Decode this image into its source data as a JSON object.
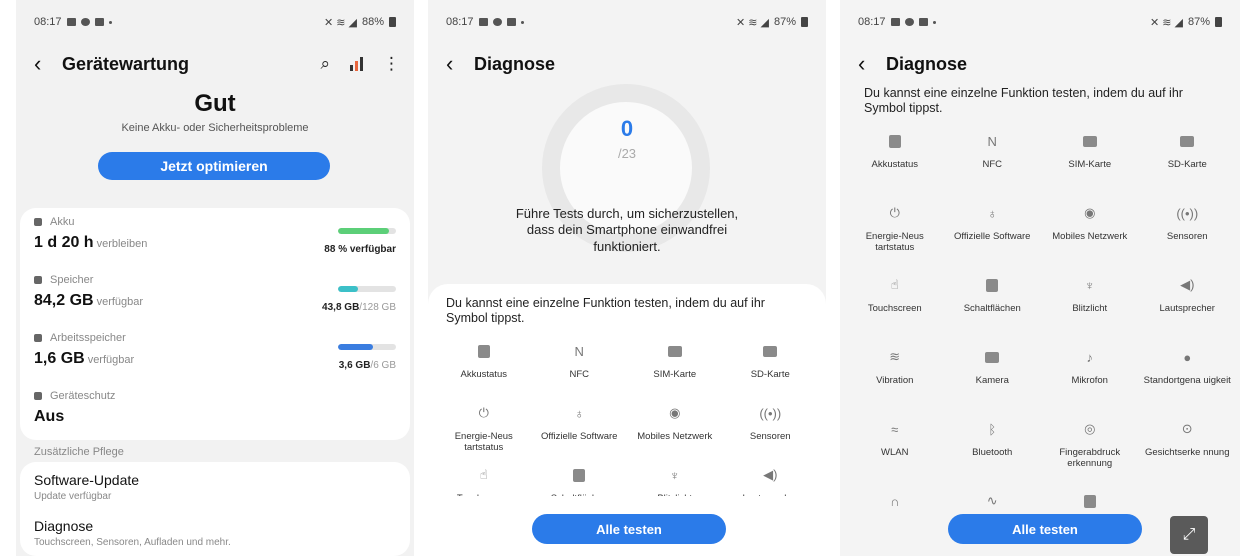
{
  "screen1": {
    "statusbar": {
      "time": "08:17",
      "battery": "88%"
    },
    "title": "Gerätewartung",
    "status": "Gut",
    "status_sub": "Keine Akku- oder Sicherheitsprobleme",
    "optimize_label": "Jetzt optimieren",
    "stats": [
      {
        "label": "Akku",
        "value": "1 d 20 h",
        "unit": "verbleiben",
        "meta_main": "88 % verfügbar",
        "meta_dim": "",
        "fill": 0.88,
        "color": "#5ccf78"
      },
      {
        "label": "Speicher",
        "value": "84,2 GB",
        "unit": "verfügbar",
        "meta_main": "43,8 GB",
        "meta_dim": "/128 GB",
        "fill": 0.34,
        "color": "#3cc0c8"
      },
      {
        "label": "Arbeitsspeicher",
        "value": "1,6 GB",
        "unit": "verfügbar",
        "meta_main": "3,6 GB",
        "meta_dim": "/6 GB",
        "fill": 0.6,
        "color": "#3a7de0"
      },
      {
        "label": "Geräteschutz",
        "value": "Aus",
        "unit": "",
        "meta_main": "",
        "meta_dim": "",
        "fill": null,
        "color": ""
      }
    ],
    "section_label": "Zusätzliche Pflege",
    "items": [
      {
        "title": "Software-Update",
        "sub": "Update verfügbar"
      },
      {
        "title": "Diagnose",
        "sub": "Touchscreen, Sensoren, Aufladen und mehr."
      }
    ]
  },
  "screen2": {
    "statusbar": {
      "time": "08:17",
      "battery": "87%"
    },
    "title": "Diagnose",
    "ring_value": "0",
    "ring_total": "/23",
    "text": "Führe Tests durch, um sicherzustellen, dass dein Smartphone einwandfrei funktioniert.",
    "hint": "Du kannst eine einzelne Funktion testen, indem du auf ihr Symbol tippst.",
    "button": "Alle testen"
  },
  "screen3": {
    "statusbar": {
      "time": "08:17",
      "battery": "87%"
    },
    "title": "Diagnose",
    "hint": "Du kannst eine einzelne Funktion testen, indem du auf ihr Symbol tippst.",
    "button": "Alle testen"
  },
  "functions": [
    {
      "name": "Akkustatus",
      "icon": "battery-icon",
      "glyph": "box"
    },
    {
      "name": "NFC",
      "icon": "nfc-icon",
      "glyph": "N"
    },
    {
      "name": "SIM-Karte",
      "icon": "sim-card-icon",
      "glyph": "wide"
    },
    {
      "name": "SD-Karte",
      "icon": "sd-card-icon",
      "glyph": "wide"
    },
    {
      "name": "Energie-Neus tartstatus",
      "icon": "power-icon",
      "glyph": "⏻"
    },
    {
      "name": "Offizielle Software",
      "icon": "badge-icon",
      "glyph": "♁"
    },
    {
      "name": "Mobiles Netzwerk",
      "icon": "cell-network-icon",
      "glyph": "◉"
    },
    {
      "name": "Sensoren",
      "icon": "sensors-icon",
      "glyph": "((•))"
    },
    {
      "name": "Touchscreen",
      "icon": "touch-icon",
      "glyph": "☝"
    },
    {
      "name": "Schaltflächen",
      "icon": "buttons-icon",
      "glyph": "box"
    },
    {
      "name": "Blitzlicht",
      "icon": "flashlight-icon",
      "glyph": "♆"
    },
    {
      "name": "Lautsprecher",
      "icon": "speaker-icon",
      "glyph": "◀)"
    },
    {
      "name": "Vibration",
      "icon": "vibration-icon",
      "glyph": "≋"
    },
    {
      "name": "Kamera",
      "icon": "camera-icon",
      "glyph": "wide"
    },
    {
      "name": "Mikrofon",
      "icon": "microphone-icon",
      "glyph": "♪"
    },
    {
      "name": "Standortgena uigkeit",
      "icon": "location-icon",
      "glyph": "●"
    },
    {
      "name": "WLAN",
      "icon": "wifi-icon",
      "glyph": "≈"
    },
    {
      "name": "Bluetooth",
      "icon": "bluetooth-icon",
      "glyph": "ᛒ"
    },
    {
      "name": "Fingerabdruck erkennung",
      "icon": "fingerprint-icon",
      "glyph": "◎"
    },
    {
      "name": "Gesichtserke nnung",
      "icon": "face-recognition-icon",
      "glyph": "⊙"
    },
    {
      "name": "",
      "icon": "headphones-icon",
      "glyph": "∩"
    },
    {
      "name": "",
      "icon": "charging-icon",
      "glyph": "∿"
    },
    {
      "name": "",
      "icon": "usb-icon",
      "glyph": "box"
    }
  ]
}
